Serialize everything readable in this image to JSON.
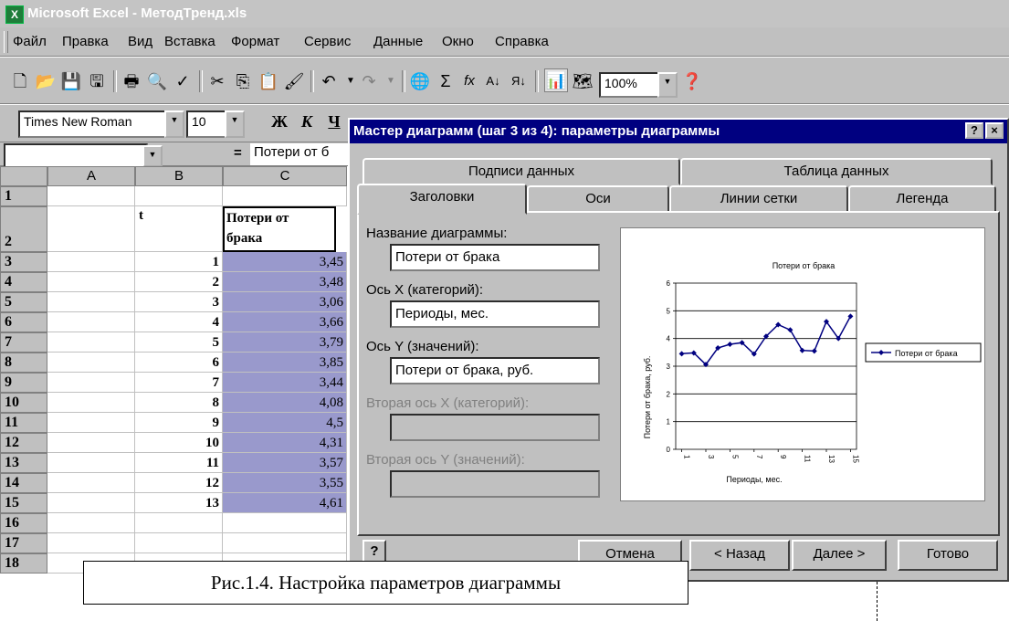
{
  "window": {
    "title": "Microsoft Excel - МетодТренд.xls"
  },
  "menu": [
    "Файл",
    "Правка",
    "Вид",
    "Вставка",
    "Формат",
    "Сервис",
    "Данные",
    "Окно",
    "Справка"
  ],
  "toolbar": {
    "zoom": "100%"
  },
  "format_toolbar": {
    "font": "Times New Roman",
    "size": "10",
    "bold": "Ж",
    "italic": "К",
    "underline": "Ч"
  },
  "formula_bar": {
    "equals": "=",
    "content": "Потери от б"
  },
  "sheet": {
    "columns": [
      "A",
      "B",
      "C"
    ],
    "header_row": {
      "t": "t",
      "loss_line1": "Потери от",
      "loss_line2": "брака"
    },
    "rows": [
      {
        "n": "1",
        "t": "",
        "v": ""
      },
      {
        "n": "2",
        "t": "",
        "v": ""
      },
      {
        "n": "3",
        "t": "1",
        "v": "3,45"
      },
      {
        "n": "4",
        "t": "2",
        "v": "3,48"
      },
      {
        "n": "5",
        "t": "3",
        "v": "3,06"
      },
      {
        "n": "6",
        "t": "4",
        "v": "3,66"
      },
      {
        "n": "7",
        "t": "5",
        "v": "3,79"
      },
      {
        "n": "8",
        "t": "6",
        "v": "3,85"
      },
      {
        "n": "9",
        "t": "7",
        "v": "3,44"
      },
      {
        "n": "10",
        "t": "8",
        "v": "4,08"
      },
      {
        "n": "11",
        "t": "9",
        "v": "4,5"
      },
      {
        "n": "12",
        "t": "10",
        "v": "4,31"
      },
      {
        "n": "13",
        "t": "11",
        "v": "3,57"
      },
      {
        "n": "14",
        "t": "12",
        "v": "3,55"
      },
      {
        "n": "15",
        "t": "13",
        "v": "4,61"
      },
      {
        "n": "16",
        "t": "",
        "v": ""
      },
      {
        "n": "17",
        "t": "",
        "v": ""
      },
      {
        "n": "18",
        "t": "",
        "v": ""
      }
    ]
  },
  "dialog": {
    "title": "Мастер диаграмм (шаг 3 из 4): параметры диаграммы",
    "help": "?",
    "close": "×",
    "tabs_back": [
      "Подписи данных",
      "Таблица данных"
    ],
    "tabs_front": [
      "Заголовки",
      "Оси",
      "Линии сетки",
      "Легенда"
    ],
    "fields": [
      {
        "label": "Название диаграммы:",
        "value": "Потери от брака",
        "disabled": false
      },
      {
        "label": "Ось X (категорий):",
        "value": "Периоды, мес.",
        "disabled": false
      },
      {
        "label": "Ось Y (значений):",
        "value": "Потери от брака, руб.",
        "disabled": false
      },
      {
        "label": "Вторая ось X (категорий):",
        "value": "",
        "disabled": true
      },
      {
        "label": "Вторая ось Y (значений):",
        "value": "",
        "disabled": true
      }
    ],
    "buttons": {
      "help": "?",
      "cancel": "Отмена",
      "back": "< Назад",
      "next": "Далее >",
      "finish": "Готово"
    }
  },
  "chart_data": {
    "type": "line",
    "title": "Потери от брака",
    "xlabel": "Периоды, мес.",
    "ylabel": "Потери от брака, руб.",
    "x": [
      1,
      2,
      3,
      4,
      5,
      6,
      7,
      8,
      9,
      10,
      11,
      12,
      13,
      14,
      15
    ],
    "x_tick_labels": [
      "1",
      "3",
      "5",
      "7",
      "9",
      "11",
      "13",
      "15"
    ],
    "y_tick_labels": [
      "0",
      "1",
      "2",
      "3",
      "4",
      "5",
      "6"
    ],
    "ylim": [
      0,
      6
    ],
    "grid": "horizontal",
    "legend_position": "right",
    "color": "#000080",
    "series": [
      {
        "name": "Потери от брака",
        "values": [
          3.45,
          3.48,
          3.06,
          3.66,
          3.79,
          3.85,
          3.44,
          4.08,
          4.5,
          4.31,
          3.57,
          3.55,
          4.61,
          4.0,
          4.8
        ]
      }
    ]
  },
  "caption": "Рис.1.4. Настройка параметров диаграммы"
}
